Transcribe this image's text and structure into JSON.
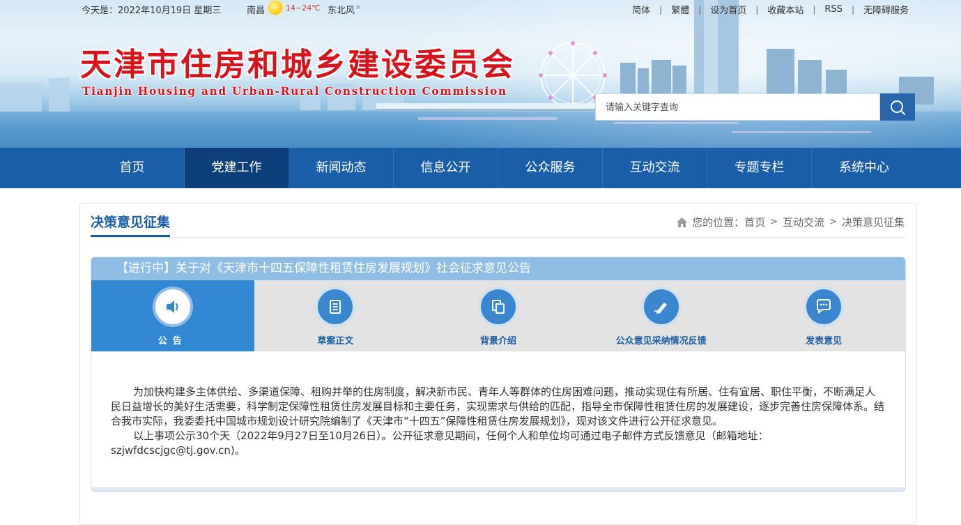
{
  "topbar": {
    "date": "今天是：2022年10月19日 星期三",
    "city": "南昌",
    "temperature": "14~24℃",
    "wind": "东北风",
    "wind_arrow": "»",
    "links": [
      "简体",
      "繁體",
      "设为首页",
      "收藏本站",
      "RSS",
      "无障碍服务"
    ],
    "separator": "|"
  },
  "header": {
    "title_cn": "天津市住房和城乡建设委员会",
    "title_en": "Tianjin Housing and Urban-Rural Construction Commission",
    "search_placeholder": "请输入关键字查询",
    "search_icon": "search-icon"
  },
  "nav": {
    "items": [
      "首页",
      "党建工作",
      "新闻动态",
      "信息公开",
      "公众服务",
      "互动交流",
      "专题专栏",
      "系统中心"
    ],
    "active_index": 1
  },
  "page": {
    "section_title": "决策意见征集",
    "breadcrumb": {
      "prefix": "您的位置：",
      "items": [
        "首页",
        "互动交流",
        "决策意见征集"
      ],
      "separator": ">",
      "home_icon": "home-icon"
    }
  },
  "notice": {
    "title": "【进行中】关于对《天津市十四五保障性租赁住房发展规划》社会征求意见公告",
    "tabs": [
      {
        "label": "公告",
        "icon": "speaker-icon"
      },
      {
        "label": "草案正文",
        "icon": "document-icon"
      },
      {
        "label": "背景介绍",
        "icon": "copy-icon"
      },
      {
        "label": "公众意见采纳情况反馈",
        "icon": "pen-icon"
      },
      {
        "label": "发表意见",
        "icon": "chat-icon"
      }
    ],
    "active_tab": 0,
    "paragraphs": [
      "为加快构建多主体供给、多渠道保障、租购并举的住房制度，解决新市民、青年人等群体的住房困难问题，推动实现住有所居、住有宜居、职住平衡，不断满足人民日益增长的美好生活需要，科学制定保障性租赁住房发展目标和主要任务，实现需求与供给的匹配，指导全市保障性租赁住房的发展建设，逐步完善住房保障体系。结合我市实际，我委委托中国城市规划设计研究院编制了《天津市“十四五”保障性租赁住房发展规划》，现对该文件进行公开征求意见。",
      "以上事项公示30个天（2022年9月27日至10月26日）。公开征求意见期间，任何个人和单位均可通过电子邮件方式反馈意见（邮箱地址：szjwfdcscjgc@tj.gov.cn)。"
    ]
  },
  "colors": {
    "nav_bg": "#1a5ea8",
    "nav_active": "#0d3f7a",
    "title_red": "#d8131b",
    "tab_active": "#3388d3",
    "notice_header": "#8fbde3"
  }
}
